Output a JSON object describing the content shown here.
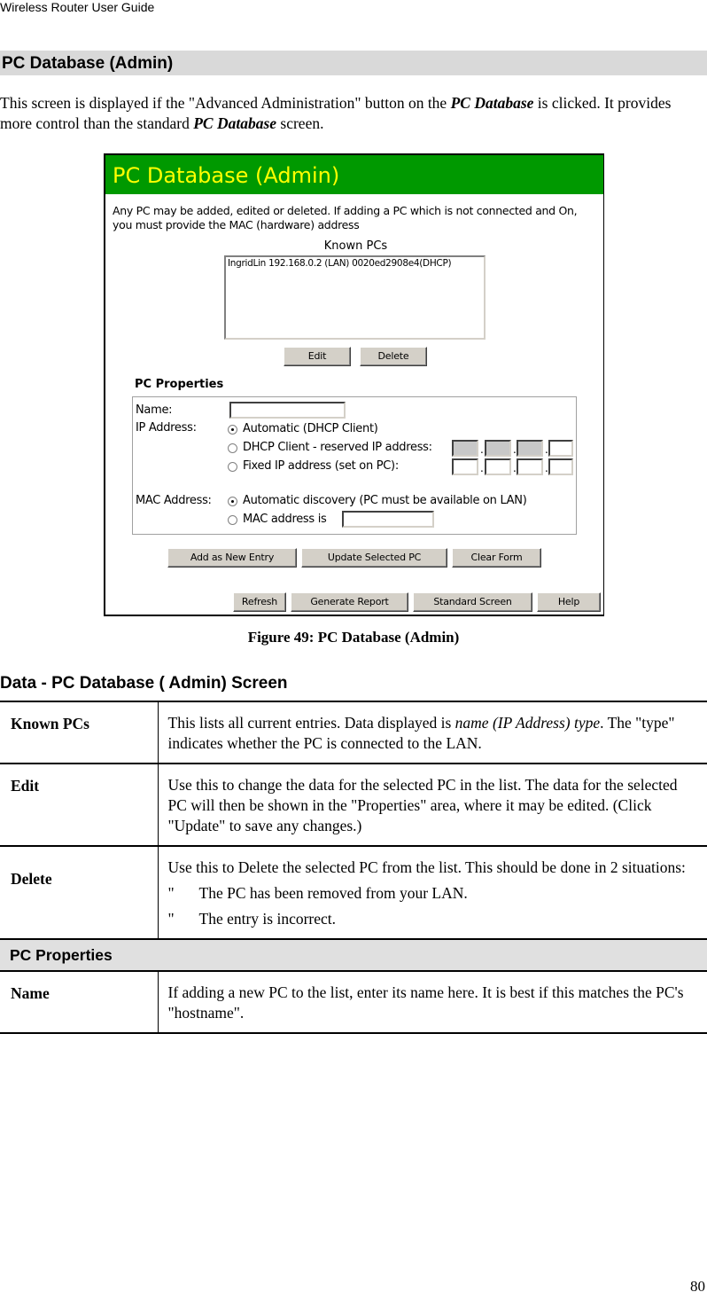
{
  "running_header": "Wireless Router User Guide",
  "section_title": "PC Database (Admin)",
  "intro": {
    "part1": "This screen is displayed if the \"Advanced Administration\" button on the ",
    "emph1": "PC Database",
    "part2": " is clicked. It provides more control than the standard ",
    "emph2": "PC Database",
    "part3": " screen."
  },
  "figure": {
    "banner_title": "PC Database (Admin)",
    "banner_bg": "#009900",
    "banner_fg": "#ffff00",
    "description": "Any PC may be added, edited or deleted. If adding a PC which is not connected and On, you must provide the MAC (hardware) address",
    "known_pcs_label": "Known PCs",
    "known_pcs": [
      "IngridLin 192.168.0.2 (LAN) 0020ed2908e4(DHCP)"
    ],
    "edit_button": "Edit",
    "delete_button": "Delete",
    "properties_title": "PC Properties",
    "name_label": "Name:",
    "name_value": "",
    "ip_label": "IP Address:",
    "ip_options": [
      {
        "label": "Automatic (DHCP Client)",
        "selected": true
      },
      {
        "label": "DHCP Client - reserved IP address:",
        "selected": false
      },
      {
        "label": "Fixed IP address (set on PC):",
        "selected": false
      }
    ],
    "mac_label": "MAC Address:",
    "mac_options": [
      {
        "label": "Automatic discovery (PC must be available on LAN)",
        "selected": true
      },
      {
        "label": "MAC address is",
        "selected": false
      }
    ],
    "mac_value": "",
    "add_button": "Add as New Entry",
    "update_button": "Update Selected PC",
    "clear_button": "Clear Form",
    "refresh_button": "Refresh",
    "report_button": "Generate Report",
    "standard_button": "Standard Screen",
    "help_button": "Help"
  },
  "caption": "Figure 49: PC Database (Admin)",
  "data_title": "Data - PC Database ( Admin) Screen",
  "table": {
    "known_term": "Known PCs",
    "known_desc1": "This lists all current entries. Data displayed is ",
    "known_desc_em": "name (IP Address) type",
    "known_desc2": ". The \"type\" indicates whether the PC is connected to the LAN.",
    "edit_term": "Edit",
    "edit_desc": "Use this to change the data for the selected PC in the list. The data for the selected PC will then be shown in the \"Properties\" area, where it may be edited. (Click \"Update\" to save any changes.)",
    "delete_term": "Delete",
    "delete_desc": "Use this to Delete the selected PC from the list. This should be done in 2 situations:",
    "delete_bullets": [
      "The PC has been removed from your LAN.",
      "The entry is incorrect."
    ],
    "bullet_mark": "\"",
    "subheader": "PC Properties",
    "name_term": "Name",
    "name_desc": "If adding a new PC to the list, enter its name here. It is best if this matches the PC's \"hostname\"."
  },
  "page_number": "80"
}
